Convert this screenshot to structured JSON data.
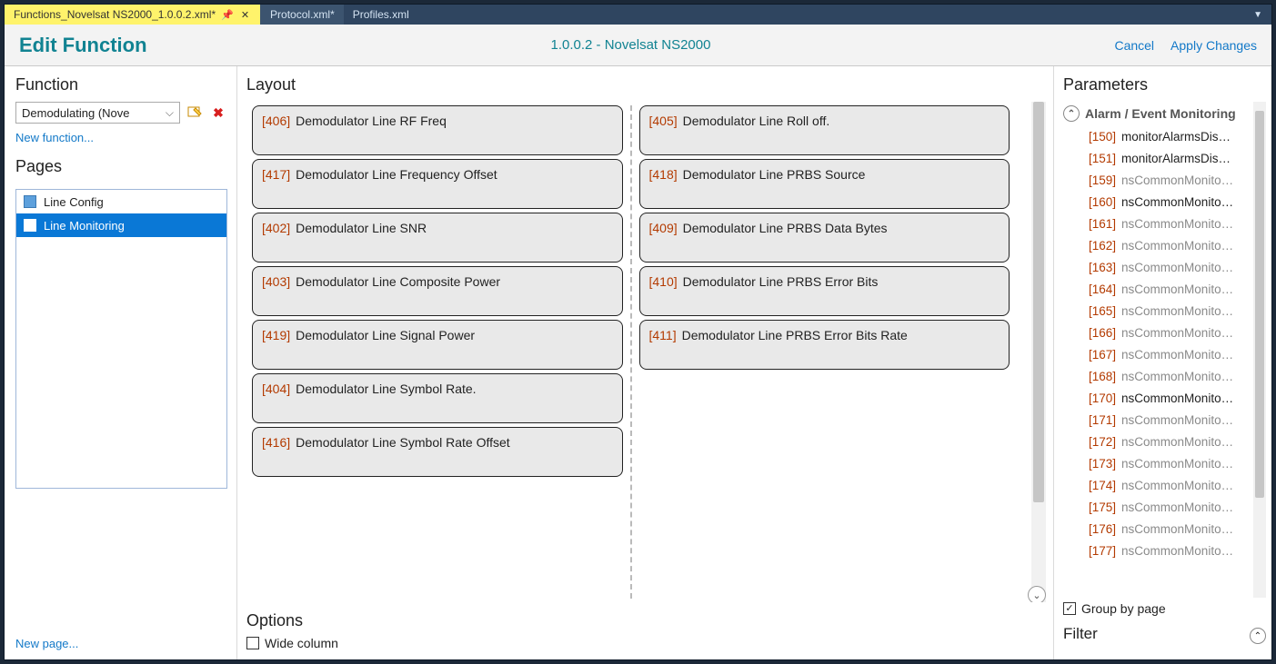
{
  "tabs": [
    {
      "label": "Functions_Novelsat NS2000_1.0.0.2.xml*",
      "active": true
    },
    {
      "label": "Protocol.xml*",
      "active": false
    },
    {
      "label": "Profiles.xml",
      "active": false
    }
  ],
  "header": {
    "title": "Edit Function",
    "subtitle": "1.0.0.2 - Novelsat NS2000",
    "cancel": "Cancel",
    "apply": "Apply Changes"
  },
  "left": {
    "function_h": "Function",
    "selected_function": "Demodulating (Nove",
    "new_function": "New function...",
    "pages_h": "Pages",
    "pages": [
      {
        "label": "Line Config",
        "selected": false
      },
      {
        "label": "Line Monitoring",
        "selected": true
      }
    ],
    "new_page": "New page..."
  },
  "layout": {
    "h": "Layout",
    "col1": [
      {
        "id": "406",
        "name": "Demodulator Line RF Freq"
      },
      {
        "id": "417",
        "name": "Demodulator Line Frequency Offset"
      },
      {
        "id": "402",
        "name": "Demodulator Line SNR"
      },
      {
        "id": "403",
        "name": "Demodulator Line Composite Power"
      },
      {
        "id": "419",
        "name": "Demodulator Line Signal Power"
      },
      {
        "id": "404",
        "name": "Demodulator Line Symbol Rate."
      },
      {
        "id": "416",
        "name": "Demodulator Line Symbol Rate Offset"
      }
    ],
    "col2": [
      {
        "id": "405",
        "name": "Demodulator Line Roll off."
      },
      {
        "id": "418",
        "name": "Demodulator Line PRBS Source"
      },
      {
        "id": "409",
        "name": "Demodulator Line PRBS Data Bytes"
      },
      {
        "id": "410",
        "name": "Demodulator Line PRBS Error Bits"
      },
      {
        "id": "411",
        "name": "Demodulator Line PRBS Error Bits Rate"
      }
    ]
  },
  "options": {
    "h": "Options",
    "wide_label": "Wide column",
    "wide_checked": false
  },
  "params": {
    "h": "Parameters",
    "group": "Alarm / Event Monitoring",
    "items": [
      {
        "id": "150",
        "name": "monitorAlarmsDis…",
        "dim": false
      },
      {
        "id": "151",
        "name": "monitorAlarmsDis…",
        "dim": false
      },
      {
        "id": "159",
        "name": "nsCommonMonito…",
        "dim": true
      },
      {
        "id": "160",
        "name": "nsCommonMonito…",
        "dim": false
      },
      {
        "id": "161",
        "name": "nsCommonMonito…",
        "dim": true
      },
      {
        "id": "162",
        "name": "nsCommonMonito…",
        "dim": true
      },
      {
        "id": "163",
        "name": "nsCommonMonito…",
        "dim": true
      },
      {
        "id": "164",
        "name": "nsCommonMonito…",
        "dim": true
      },
      {
        "id": "165",
        "name": "nsCommonMonito…",
        "dim": true
      },
      {
        "id": "166",
        "name": "nsCommonMonito…",
        "dim": true
      },
      {
        "id": "167",
        "name": "nsCommonMonito…",
        "dim": true
      },
      {
        "id": "168",
        "name": "nsCommonMonito…",
        "dim": true
      },
      {
        "id": "170",
        "name": "nsCommonMonito…",
        "dim": false
      },
      {
        "id": "171",
        "name": "nsCommonMonito…",
        "dim": true
      },
      {
        "id": "172",
        "name": "nsCommonMonito…",
        "dim": true
      },
      {
        "id": "173",
        "name": "nsCommonMonito…",
        "dim": true
      },
      {
        "id": "174",
        "name": "nsCommonMonito…",
        "dim": true
      },
      {
        "id": "175",
        "name": "nsCommonMonito…",
        "dim": true
      },
      {
        "id": "176",
        "name": "nsCommonMonito…",
        "dim": true
      },
      {
        "id": "177",
        "name": "nsCommonMonito…",
        "dim": true
      }
    ],
    "group_by_label": "Group by page",
    "group_by_checked": true,
    "filter_h": "Filter"
  }
}
